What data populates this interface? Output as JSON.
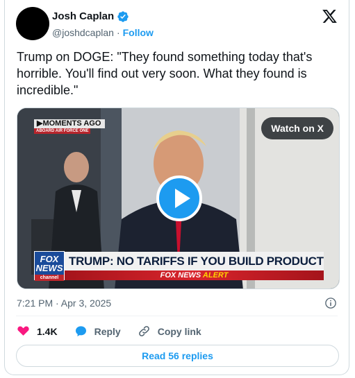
{
  "author": {
    "name": "Josh Caplan",
    "handle": "@joshdcaplan",
    "separator": "·",
    "follow_label": "Follow"
  },
  "tweet": {
    "text": "Trump on DOGE: \"They found something today that's horrible. You'll find out very soon. What they found is incredible.\"",
    "timestamp": "7:21 PM · Apr 3, 2025"
  },
  "media": {
    "watch_label": "Watch on X",
    "overlay": {
      "moments": "▶MOMENTS AGO",
      "aboard": "ABOARD AIR FORCE ONE",
      "fox_logo_line1": "FOX",
      "fox_logo_line2": "NEWS",
      "fox_logo_line3": "channel",
      "chyron": "TRUMP: NO TARIFFS IF YOU BUILD PRODUCTS IN U.S.",
      "alert_brand": "FOX NEWS",
      "alert_word": "ALERT"
    }
  },
  "actions": {
    "likes": "1.4K",
    "reply_label": "Reply",
    "copy_label": "Copy link"
  },
  "read_replies_label": "Read 56 replies",
  "icons": [
    "verified-icon",
    "x-logo-icon",
    "play-icon",
    "info-icon",
    "heart-icon",
    "reply-icon",
    "link-icon"
  ],
  "colors": {
    "accent": "#1d9bf0",
    "like": "#f91880",
    "secondary_text": "#536471",
    "text": "#0f1419"
  }
}
